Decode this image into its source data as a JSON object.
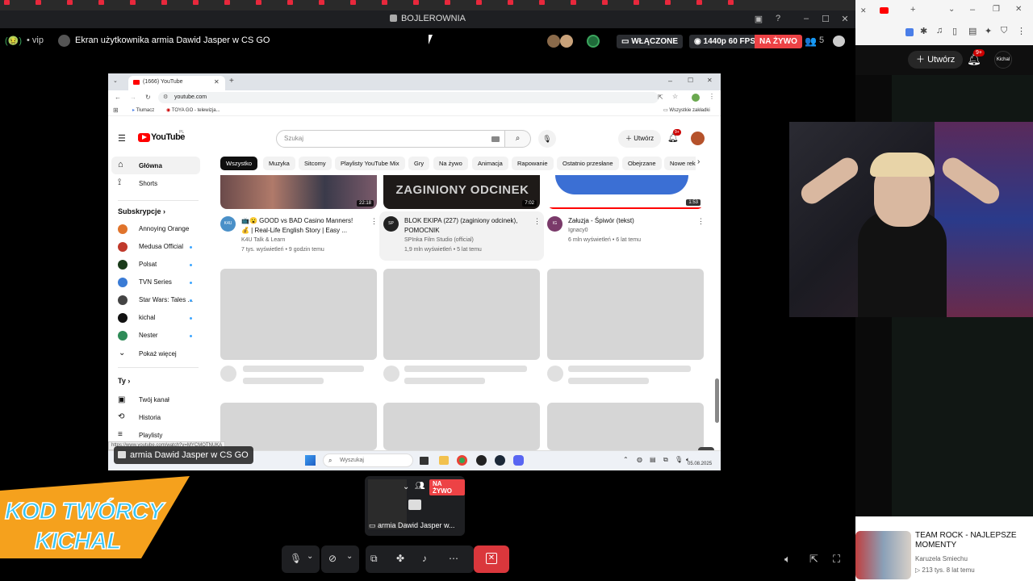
{
  "window": {
    "title": "BOJLEROWNIA",
    "top_tabs": [
      "",
      "",
      "",
      "",
      "",
      "",
      "",
      "",
      "",
      "",
      "",
      "",
      "",
      "",
      "",
      "",
      "",
      "",
      "",
      "",
      "",
      "",
      "",
      ""
    ]
  },
  "stream_header": {
    "server_emoji": "(🤢)",
    "server_name": "• vip",
    "stream_title": "Ekran użytkownika armia Dawid Jasper w CS GO",
    "watch_label": "WŁĄCZONE",
    "quality": "1440p 60 FPS",
    "live": "NA ŻYWO",
    "viewer_count": "5"
  },
  "right_panel": {
    "create_label": "Utwórz",
    "notif_badge": "9+",
    "avatar_text": "Kichal",
    "video": {
      "title": "TEAM ROCK - NAJLEPSZE MOMENTY",
      "channel": "Karuzela Smiechu",
      "meta": "▷ 213 tys.  8 lat temu"
    }
  },
  "inner_browser": {
    "tab_title": "(1666) YouTube",
    "url": "youtube.com",
    "bookmarks": [
      "Tłumacz",
      "TOYA GO - telewizja..."
    ],
    "all_bookmarks": "Wszystkie zakładki",
    "status_url": "https://www.youtube.com/watch?v=MYCMOTNUKA"
  },
  "youtube": {
    "logo_text": "YouTube",
    "logo_region": "PL",
    "search_placeholder": "Szukaj",
    "create_label": "Utwórz",
    "notif_badge": "9+",
    "sidebar": {
      "home": "Główna",
      "shorts": "Shorts",
      "subs_header": "Subskrypcje",
      "subscriptions": [
        {
          "name": "Annoying Orange",
          "color": "#e0742c",
          "dot": false
        },
        {
          "name": "Medusa Official",
          "color": "#c0392b",
          "dot": true
        },
        {
          "name": "Polsat",
          "color": "#1a3b1a",
          "dot": true
        },
        {
          "name": "TVN Series",
          "color": "#3a7bd5",
          "dot": true
        },
        {
          "name": "Star Wars: Tales ...",
          "color": "#444444",
          "dot": true
        },
        {
          "name": "kichal",
          "color": "#111111",
          "dot": true
        },
        {
          "name": "Nester",
          "color": "#2e8b57",
          "dot": true
        }
      ],
      "show_more": "Pokaż więcej",
      "you_header": "Ty",
      "your_channel": "Twój kanał",
      "history": "Historia",
      "playlists": "Playlisty"
    },
    "chips": [
      "Wszystko",
      "Muzyka",
      "Sitcomy",
      "Playlisty YouTube Mix",
      "Gry",
      "Na żywo",
      "Animacja",
      "Rapowanie",
      "Ostatnio przesłane",
      "Obejrzane",
      "Nowe reko"
    ],
    "videos": [
      {
        "title_line1": "📺😮 GOOD vs BAD Casino Manners!",
        "title_line2": "💰 | Real-Life English Story | Easy ...",
        "channel": "K4U Talk & Learn",
        "meta": "7 tys. wyświetleń • 9 godzin temu",
        "duration": "22:18",
        "avatar": "K4U"
      },
      {
        "title_line1": "BLOK EKIPA (227) (zaginiony odcinek),",
        "title_line2": "POMOCNIK",
        "channel": "SPInka Film Studio (official)",
        "meta": "1,9 mln wyświetleń • 5 lat temu",
        "duration": "7:02",
        "thumb_text": "ZAGINIONY ODCINEK",
        "avatar": "SP"
      },
      {
        "title_line1": "Załuzja - Śpiwór (tekst)",
        "title_line2": "",
        "channel": "Ignacy0",
        "meta": "6 mln wyświetleń • 6 lat temu",
        "duration": "1:53",
        "avatar": "IG"
      }
    ]
  },
  "taskbar": {
    "search_placeholder": "Wyszukaj",
    "date": "05.08.2025"
  },
  "stream_label": "armia Dawid Jasper w CS GO",
  "preview": {
    "live": "NA ŻYWO",
    "label": "armia Dawid Jasper w..."
  },
  "overlay": {
    "line1": "KOD TWÓRCY",
    "line2": "KICHAL"
  },
  "colors": {
    "discord_red": "#da373c",
    "live_red": "#ed4245",
    "yt_red": "#ff0000",
    "overlay_orange": "#f5a11d",
    "overlay_blue": "#3bc4f2"
  }
}
